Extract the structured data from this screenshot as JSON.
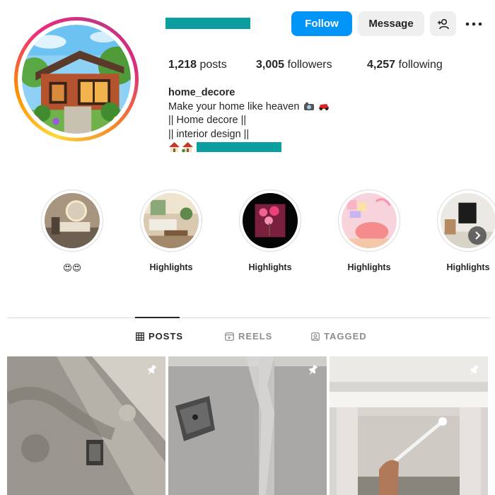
{
  "profile": {
    "username": "home_decore",
    "bio_lines": [
      "Make your home like heaven",
      "|| Home decore ||",
      "|| interior design ||"
    ]
  },
  "actions": {
    "follow_label": "Follow",
    "message_label": "Message",
    "add_user_icon": "person-add-icon",
    "more_icon": "more-options-icon"
  },
  "stats": {
    "posts_count": "1,218",
    "posts_label": "posts",
    "followers_count": "3,005",
    "followers_label": "followers",
    "following_count": "4,257",
    "following_label": "following"
  },
  "highlights": [
    {
      "label": "😍😍"
    },
    {
      "label": "Highlights"
    },
    {
      "label": "Highlights"
    },
    {
      "label": "Highlights"
    },
    {
      "label": "Highlights"
    }
  ],
  "tabs": [
    {
      "label": "POSTS",
      "icon": "grid-icon",
      "active": true
    },
    {
      "label": "REELS",
      "icon": "reels-icon",
      "active": false
    },
    {
      "label": "TAGGED",
      "icon": "tagged-icon",
      "active": false
    }
  ],
  "posts": [
    {
      "pinned": true
    },
    {
      "pinned": true
    },
    {
      "pinned": true
    }
  ],
  "colors": {
    "follow_button": "#0095f6",
    "secondary_button": "#efefef",
    "redaction": "#0b9ea0"
  }
}
